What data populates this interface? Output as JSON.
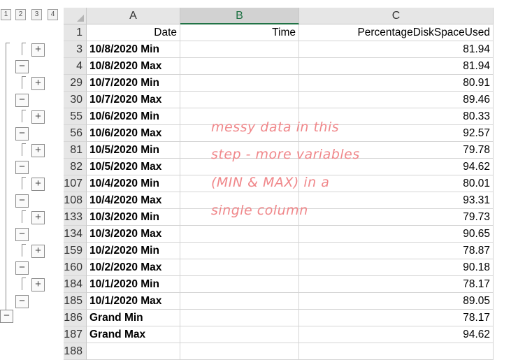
{
  "outline_levels": [
    "1",
    "2",
    "3",
    "4"
  ],
  "columns": [
    {
      "label": "A",
      "selected": false
    },
    {
      "label": "B",
      "selected": true
    },
    {
      "label": "C",
      "selected": false
    }
  ],
  "rows": [
    {
      "num": "1",
      "a": "Date",
      "b": "Time",
      "c": "PercentageDiskSpaceUsed",
      "header": true
    },
    {
      "num": "3",
      "a": "10/8/2020 Min",
      "b": "",
      "c": "81.94"
    },
    {
      "num": "4",
      "a": "10/8/2020 Max",
      "b": "",
      "c": "81.94"
    },
    {
      "num": "29",
      "a": "10/7/2020 Min",
      "b": "",
      "c": "80.91"
    },
    {
      "num": "30",
      "a": "10/7/2020 Max",
      "b": "",
      "c": "89.46"
    },
    {
      "num": "55",
      "a": "10/6/2020 Min",
      "b": "",
      "c": "80.33"
    },
    {
      "num": "56",
      "a": "10/6/2020 Max",
      "b": "",
      "c": "92.57"
    },
    {
      "num": "81",
      "a": "10/5/2020 Min",
      "b": "",
      "c": "79.78"
    },
    {
      "num": "82",
      "a": "10/5/2020 Max",
      "b": "",
      "c": "94.62"
    },
    {
      "num": "107",
      "a": "10/4/2020 Min",
      "b": "",
      "c": "80.01"
    },
    {
      "num": "108",
      "a": "10/4/2020 Max",
      "b": "",
      "c": "93.31"
    },
    {
      "num": "133",
      "a": "10/3/2020 Min",
      "b": "",
      "c": "79.73"
    },
    {
      "num": "134",
      "a": "10/3/2020 Max",
      "b": "",
      "c": "90.65"
    },
    {
      "num": "159",
      "a": "10/2/2020 Min",
      "b": "",
      "c": "78.87"
    },
    {
      "num": "160",
      "a": "10/2/2020 Max",
      "b": "",
      "c": "90.18"
    },
    {
      "num": "184",
      "a": "10/1/2020 Min",
      "b": "",
      "c": "78.17"
    },
    {
      "num": "185",
      "a": "10/1/2020 Max",
      "b": "",
      "c": "89.05"
    },
    {
      "num": "186",
      "a": "Grand Min",
      "b": "",
      "c": "78.17"
    },
    {
      "num": "187",
      "a": "Grand Max",
      "b": "",
      "c": "94.62"
    },
    {
      "num": "188",
      "a": "",
      "b": "",
      "c": ""
    }
  ],
  "expand_symbol": "+",
  "collapse_symbol": "−",
  "annotation": {
    "lines": [
      "messy data in this",
      "step - more variables",
      "(MIN & MAX) in a",
      "single column"
    ],
    "color": "#f0878a"
  }
}
